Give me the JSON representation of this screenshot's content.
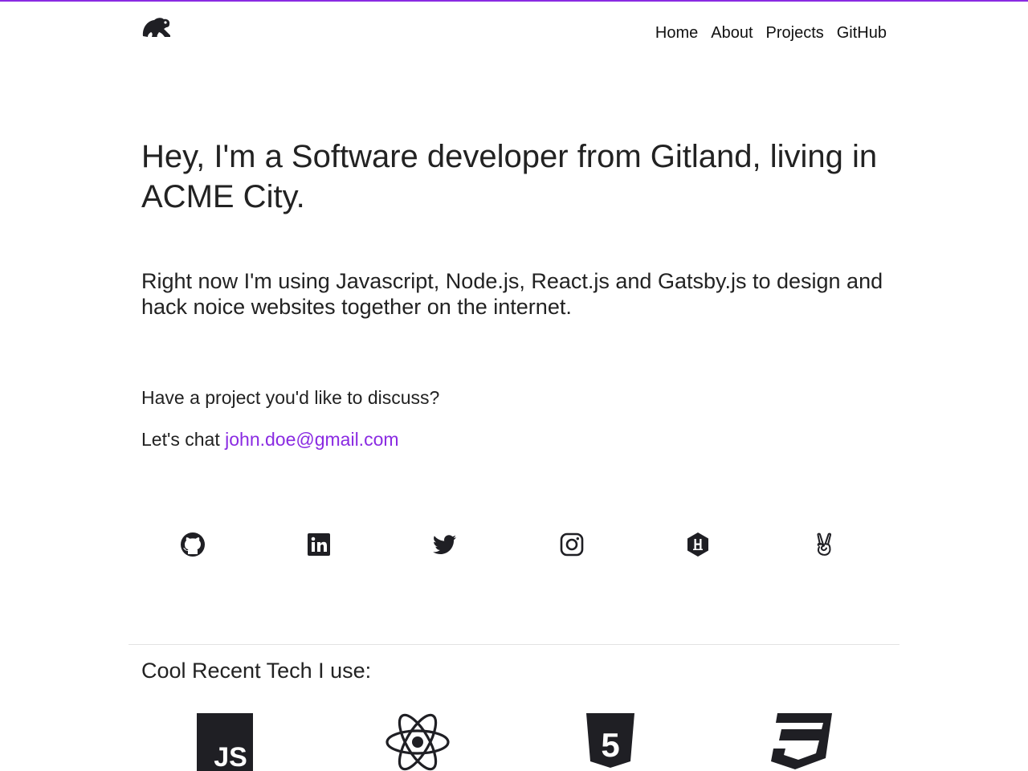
{
  "header": {
    "logo": "frog-logo",
    "nav": [
      {
        "label": "Home"
      },
      {
        "label": "About"
      },
      {
        "label": "Projects"
      },
      {
        "label": "GitHub"
      }
    ]
  },
  "hero": {
    "headline": "Hey, I'm a Software developer from Gitland, living in ACME City.",
    "intro": "Right now I'm using Javascript, Node.js, React.js and Gatsby.js to design and hack noice websites together on the internet.",
    "cta": "Have a project you'd like to discuss?",
    "chat_prefix": "Let's chat ",
    "email": "john.doe@gmail.com"
  },
  "socials": [
    {
      "icon": "github-icon"
    },
    {
      "icon": "linkedin-icon"
    },
    {
      "icon": "twitter-icon"
    },
    {
      "icon": "instagram-icon"
    },
    {
      "icon": "hackernews-icon"
    },
    {
      "icon": "angellist-icon"
    }
  ],
  "tech": {
    "title": "Cool Recent Tech I use:",
    "items": [
      {
        "icon": "javascript-icon",
        "label": "JS"
      },
      {
        "icon": "react-icon"
      },
      {
        "icon": "html5-icon",
        "label": "5"
      },
      {
        "icon": "css3-icon",
        "label": "3"
      }
    ]
  },
  "colors": {
    "accent": "#8a2be2",
    "text": "#212121",
    "icon": "#1f1f24"
  }
}
